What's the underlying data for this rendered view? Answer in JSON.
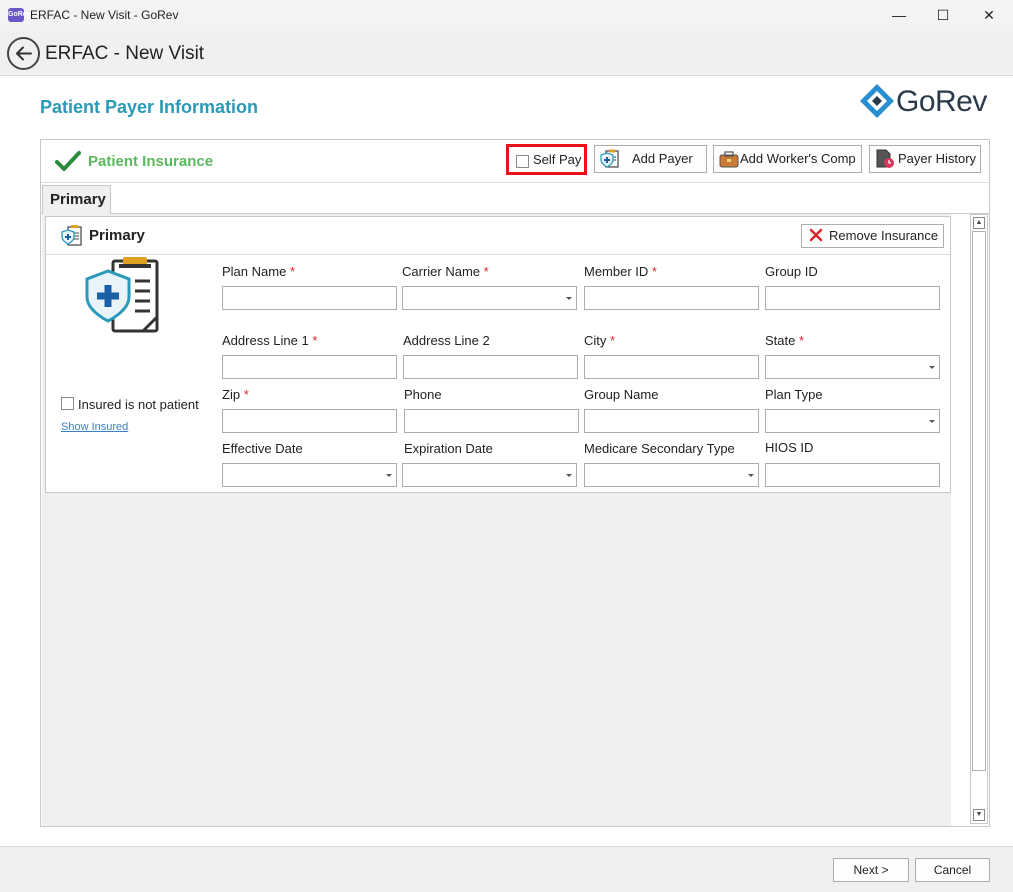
{
  "window": {
    "app_icon_text": "GoRev",
    "title": "ERFAC - New Visit - GoRev",
    "minimize": "—",
    "maximize": "☐",
    "close": "✕"
  },
  "header": {
    "title": "ERFAC - New Visit"
  },
  "page": {
    "section_title": "Patient Payer Information",
    "logo_text": "GoRev"
  },
  "insurance_panel": {
    "title": "Patient Insurance",
    "self_pay_label": "Self Pay",
    "self_pay_checked": false,
    "add_payer_label": "Add Payer",
    "add_workers_comp_label": "Add Worker's Comp",
    "payer_history_label": "Payer History",
    "tabs": [
      {
        "label": "Primary",
        "selected": true
      }
    ]
  },
  "primary_card": {
    "title": "Primary",
    "remove_label": "Remove Insurance",
    "insured_not_patient_label": "Insured is not patient",
    "insured_not_patient_checked": false,
    "show_insured_link": "Show Insured",
    "fields": [
      {
        "label": "Plan Name",
        "required": true,
        "type": "text",
        "value": ""
      },
      {
        "label": "Carrier Name",
        "required": true,
        "type": "select",
        "value": ""
      },
      {
        "label": "Member ID",
        "required": true,
        "type": "text",
        "value": ""
      },
      {
        "label": "Group ID",
        "required": false,
        "type": "text",
        "value": ""
      },
      {
        "label": "Address Line 1",
        "required": true,
        "type": "text",
        "value": ""
      },
      {
        "label": "Address Line 2",
        "required": false,
        "type": "text",
        "value": ""
      },
      {
        "label": "City",
        "required": true,
        "type": "text",
        "value": ""
      },
      {
        "label": "State",
        "required": true,
        "type": "select",
        "value": ""
      },
      {
        "label": "Zip",
        "required": true,
        "type": "text",
        "value": ""
      },
      {
        "label": "Phone",
        "required": false,
        "type": "text",
        "value": ""
      },
      {
        "label": "Group Name",
        "required": false,
        "type": "text",
        "value": ""
      },
      {
        "label": "Plan Type",
        "required": false,
        "type": "select",
        "value": ""
      },
      {
        "label": "Effective Date",
        "required": false,
        "type": "select",
        "value": ""
      },
      {
        "label": "Expiration Date",
        "required": false,
        "type": "select",
        "value": ""
      },
      {
        "label": "Medicare Secondary Type",
        "required": false,
        "type": "select",
        "value": ""
      },
      {
        "label": "HIOS ID",
        "required": false,
        "type": "text",
        "value": ""
      }
    ],
    "required_marker": "*"
  },
  "footer": {
    "next_label": "Next >",
    "cancel_label": "Cancel"
  },
  "colors": {
    "accent_title": "#2a9ab8",
    "success_green": "#5cb85c",
    "highlight_red": "#e8141c",
    "required_red": "#d9252b",
    "link_blue": "#3a82c4"
  }
}
